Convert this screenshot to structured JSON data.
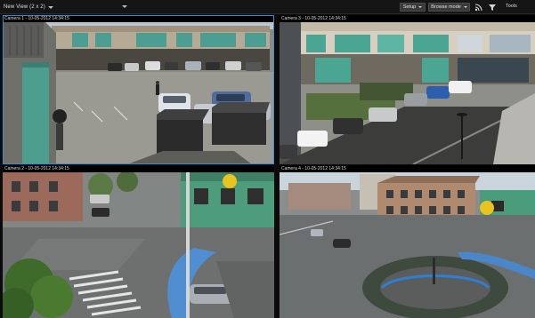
{
  "toolbar": {
    "view_name": "New View (2 x 2)",
    "setup_label": "Setup",
    "mode_label": "Browse mode",
    "right_label": "Tools",
    "icons": [
      "rss-feed-icon",
      "filter-icon"
    ]
  },
  "cameras": [
    {
      "title": "Camera 1 - 10-05-2012 14:34:15",
      "selected": true
    },
    {
      "title": "Camera 3 - 10-05-2012 14:34:15",
      "selected": false
    },
    {
      "title": "Camera 2 - 10-05-2012 14:34:15",
      "selected": false
    },
    {
      "title": "Camera 4 - 10-05-2012 14:34:15",
      "selected": false
    }
  ],
  "colors": {
    "selection": "#2f8fd9",
    "background": "#0b0b0b",
    "toolbar_button": "#3a3a3a"
  }
}
